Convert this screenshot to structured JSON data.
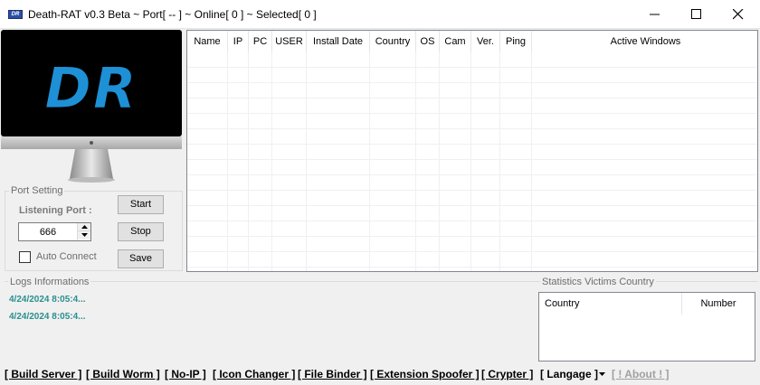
{
  "window": {
    "icon_text": "DR",
    "title": "Death-RAT v0.3 Beta ~ Port[ -- ] ~ Online[ 0 ] ~ Selected[ 0 ]"
  },
  "logo": {
    "text": "DR",
    "color": "#1e90d6"
  },
  "port_setting": {
    "legend": "Port Setting",
    "listening_label": "Listening Port :",
    "port_value": "666",
    "auto_connect_label": "Auto Connect",
    "auto_connect_checked": false
  },
  "buttons": {
    "start": "Start",
    "stop": "Stop",
    "save": "Save"
  },
  "victims": {
    "columns": [
      "Name",
      "IP",
      "PC",
      "USER",
      "Install Date",
      "Country",
      "OS",
      "Cam",
      "Ver.",
      "Ping",
      "Active Windows"
    ]
  },
  "logs": {
    "legend": "Logs Informations",
    "entries": [
      "4/24/2024 8:05:4...",
      "4/24/2024 8:05:4..."
    ],
    "text_color": "#2a8f8f"
  },
  "stats": {
    "legend": "Statistics Victims Country",
    "columns": [
      "Country",
      "Number"
    ]
  },
  "menu": {
    "items": [
      "[ Build Server ]",
      "[ Build Worm ]",
      "[ No-IP ]",
      "[ Icon Changer ]",
      "[ File Binder ]",
      "[ Extension Spoofer ]",
      "[ Crypter ]",
      "[ Langage ]",
      "[ ! About ! ]"
    ]
  }
}
